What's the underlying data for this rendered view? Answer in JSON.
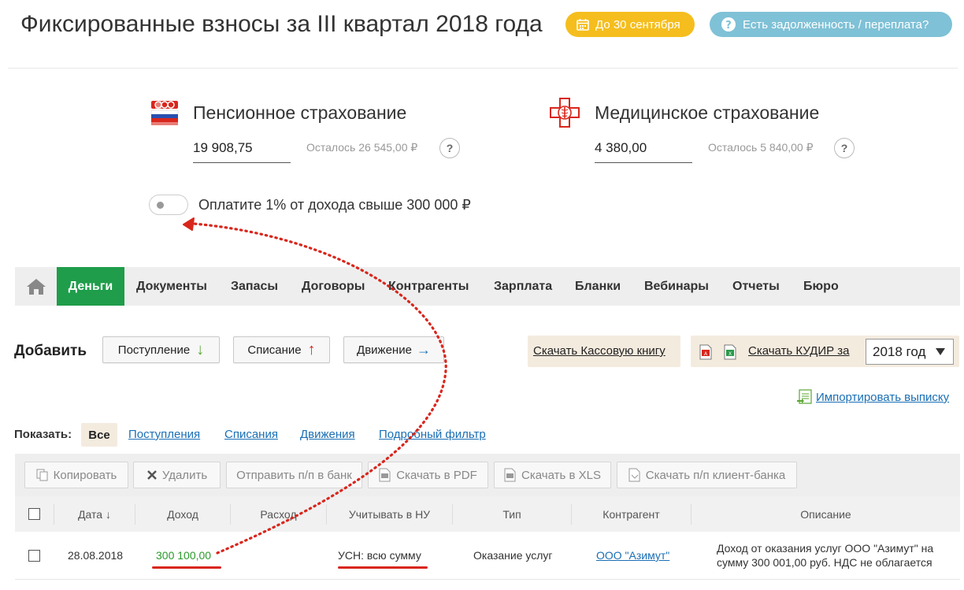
{
  "header": {
    "title": "Фиксированные взносы за III квартал 2018 года",
    "deadline_label": "До 30 сентября",
    "debt_label": "Есть задолженность / переплата?"
  },
  "pension": {
    "title": "Пенсионное страхование",
    "value": "19 908,75",
    "remaining": "Осталось 26 545,00 ₽",
    "help": "?"
  },
  "medical": {
    "title": "Медицинское страхование",
    "value": "4 380,00",
    "remaining": "Осталось 5 840,00 ₽",
    "help": "?"
  },
  "toggle": {
    "label": "Оплатите 1% от дохода свыше 300 000 ₽",
    "on": false
  },
  "nav": {
    "items": [
      "Деньги",
      "Документы",
      "Запасы",
      "Договоры",
      "Контрагенты",
      "Зарплата",
      "Бланки",
      "Вебинары",
      "Отчеты",
      "Бюро"
    ],
    "active": "Деньги"
  },
  "add": {
    "label": "Добавить",
    "income": "Поступление",
    "income_arrow": "↓",
    "expense": "Списание",
    "expense_arrow": "↑",
    "movement": "Движение",
    "movement_arrow": "→",
    "cashbook": "Скачать Кассовую книгу",
    "kudir": "Скачать КУДИР за",
    "year": "2018 год",
    "import": "Импортировать выписку"
  },
  "filters": {
    "label": "Показать:",
    "all": "Все",
    "incomes": "Поступления",
    "expenses": "Списания",
    "movements": "Движения",
    "detailed": "Подробный фильтр"
  },
  "toolbar": {
    "copy": "Копировать",
    "delete": "Удалить",
    "send": "Отправить п/п в банк",
    "pdf": "Скачать в PDF",
    "xls": "Скачать в XLS",
    "client_bank": "Скачать п/п клиент-банка"
  },
  "table": {
    "columns": {
      "date": "Дата ↓",
      "income": "Доход",
      "expense": "Расход",
      "tax": "Учитывать в НУ",
      "type": "Тип",
      "counterparty": "Контрагент",
      "description": "Описание"
    },
    "rows": [
      {
        "date": "28.08.2018",
        "income": "300 100,00",
        "tax": "УСН: всю сумму",
        "type": "Оказание услуг",
        "counterparty": "ООО \"Азимут\"",
        "description_line1": "Доход от оказания услуг ООО \"Азимут\" на",
        "description_line2": "сумму 300 001,00 руб. НДС не облагается"
      }
    ]
  },
  "colors": {
    "accent_green": "#1f9d4a",
    "pill_yellow": "#f5be1e",
    "pill_blue": "#7fc1d6",
    "income_green": "#2a9a2a",
    "annotation_red": "#d9261c"
  },
  "icons": {
    "calendar": "calendar-icon",
    "question": "question-circle-icon",
    "pfr": "pfr-logo-icon",
    "medical": "medical-cross-icon",
    "home": "home-icon"
  }
}
